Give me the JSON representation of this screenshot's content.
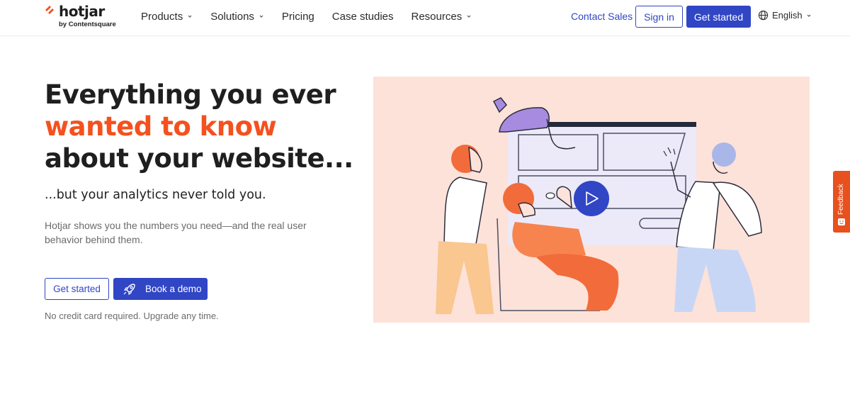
{
  "header": {
    "logo": {
      "name": "hotjar",
      "sub": "by Contentsquare"
    },
    "nav": [
      {
        "label": "Products",
        "dropdown": true
      },
      {
        "label": "Solutions",
        "dropdown": true
      },
      {
        "label": "Pricing",
        "dropdown": false
      },
      {
        "label": "Case studies",
        "dropdown": false
      },
      {
        "label": "Resources",
        "dropdown": true
      }
    ],
    "contact_sales": "Contact Sales",
    "sign_in": "Sign in",
    "get_started": "Get started",
    "language": "English"
  },
  "hero": {
    "headline_part1": "Everything you ever",
    "headline_accent": "wanted to know",
    "headline_part2": " about your website...",
    "subheadline": "...but your analytics never told you.",
    "description": "Hotjar shows you the numbers you need—and the real user behavior behind them.",
    "cta_primary": "Get started",
    "cta_demo": "Book a demo",
    "fineprint": "No credit card required. Upgrade any time."
  },
  "illustration": {
    "play_icon": "play-icon"
  },
  "feedback": {
    "label": "Feedback"
  },
  "colors": {
    "brand_blue": "#3046c5",
    "accent_orange": "#f4511e",
    "illustration_bg": "#fde2d9",
    "feedback_bg": "#e8501d"
  }
}
